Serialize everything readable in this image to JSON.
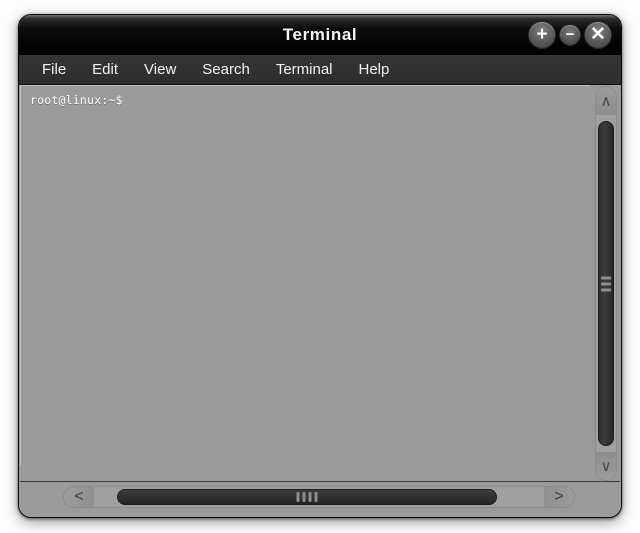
{
  "window": {
    "title": "Terminal",
    "buttons": [
      {
        "name": "maximize",
        "glyph": "+",
        "size": "big"
      },
      {
        "name": "minimize",
        "glyph": "−",
        "size": "small"
      },
      {
        "name": "close",
        "glyph": "✕",
        "size": "big"
      }
    ]
  },
  "menubar": {
    "items": [
      {
        "label": "File"
      },
      {
        "label": "Edit"
      },
      {
        "label": "View"
      },
      {
        "label": "Search"
      },
      {
        "label": "Terminal"
      },
      {
        "label": "Help"
      }
    ]
  },
  "terminal": {
    "prompt": "root@linux:~$",
    "lines": [
      "root@linux:~$"
    ],
    "background_color": "#9a9a9a",
    "text_color": "#ffffff"
  },
  "scrollbars": {
    "vertical": {
      "up_glyph": "∧",
      "down_glyph": "∨",
      "grip_lines": 3
    },
    "horizontal": {
      "left_glyph": "<",
      "right_glyph": ">",
      "grip_lines": 4
    }
  },
  "colors": {
    "titlebar": "#000000",
    "menubar": "#2f2f2f",
    "window_body": "#9a9a9a",
    "desktop": "#fdfdfd",
    "scroll_thumb": "#2e2e2e"
  }
}
